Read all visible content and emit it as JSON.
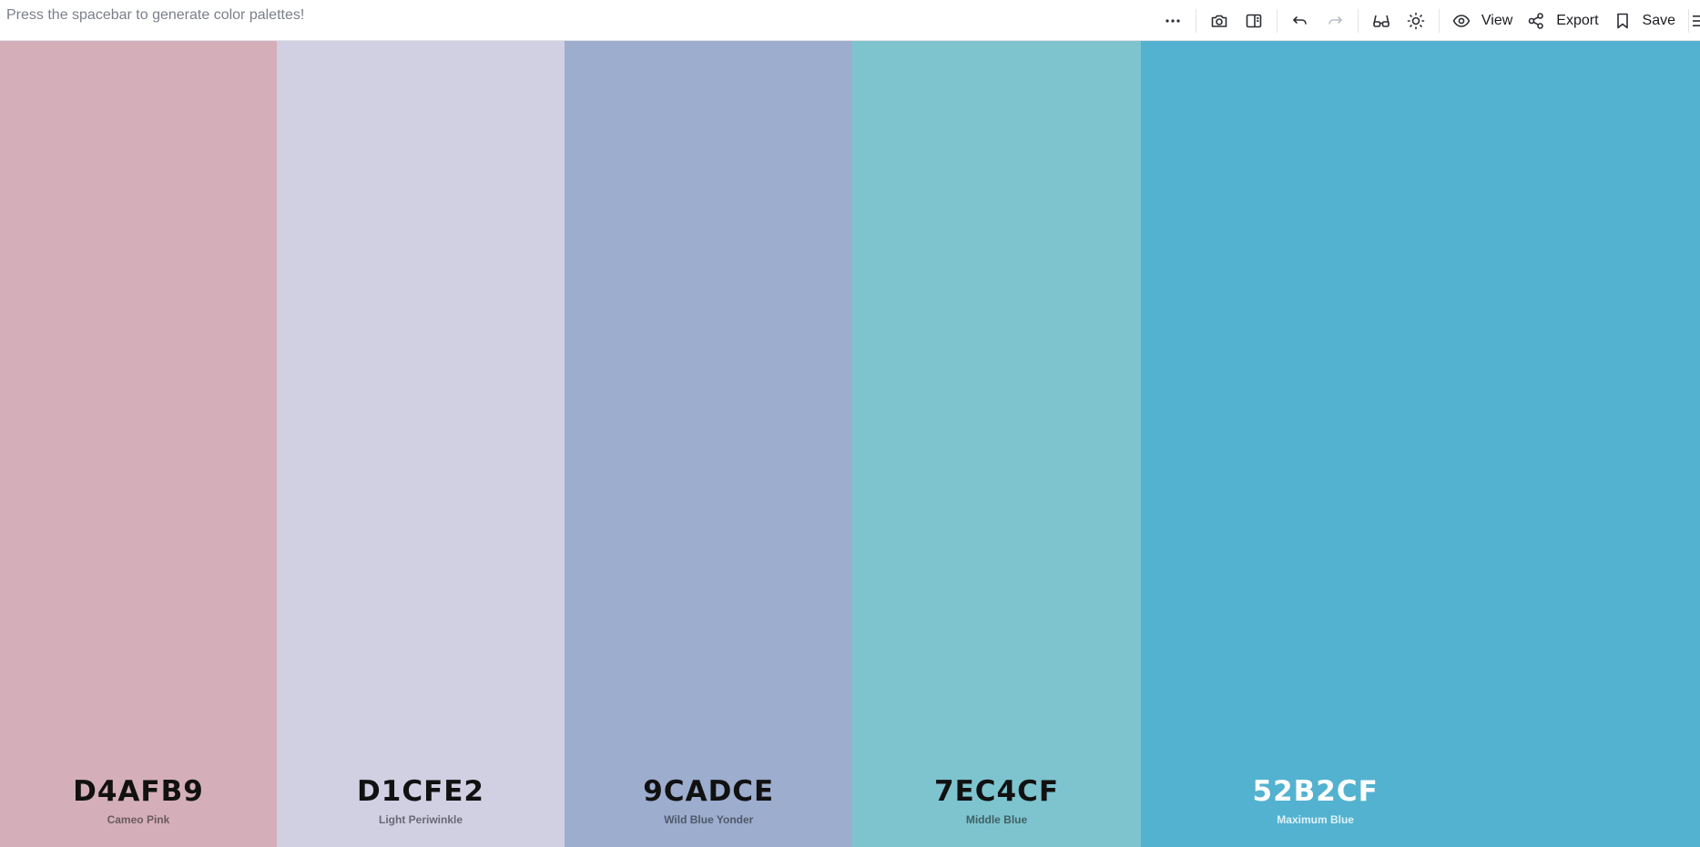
{
  "toolbar": {
    "hint": "Press the spacebar to generate color palettes!",
    "view_label": "View",
    "export_label": "Export",
    "save_label": "Save"
  },
  "palette": {
    "swatches": [
      {
        "hex": "D4AFB9",
        "name": "Cameo Pink",
        "color": "#D4AFB9",
        "text_color": "#111111",
        "name_color": "#6b5a60"
      },
      {
        "hex": "D1CFE2",
        "name": "Light Periwinkle",
        "color": "#D1CFE2",
        "text_color": "#111111",
        "name_color": "#6a6975"
      },
      {
        "hex": "9CADCE",
        "name": "Wild Blue Yonder",
        "color": "#9CADCE",
        "text_color": "#111111",
        "name_color": "#4f5869"
      },
      {
        "hex": "7EC4CF",
        "name": "Middle Blue",
        "color": "#7EC4CF",
        "text_color": "#111111",
        "name_color": "#405f64"
      },
      {
        "hex": "52B2CF",
        "name": "Maximum Blue",
        "color": "#52B2CF",
        "text_color": "#ffffff",
        "name_color": "#dff1f7"
      }
    ]
  }
}
